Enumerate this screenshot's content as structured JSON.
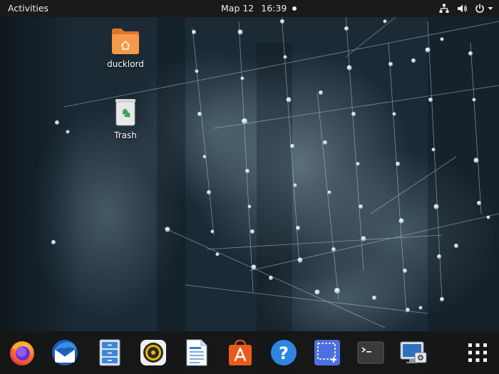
{
  "topbar": {
    "activities_label": "Activities",
    "date": "Мар 12",
    "time": "16:39",
    "tray_icons": [
      "network-icon",
      "volume-icon",
      "power-icon"
    ]
  },
  "desktop": {
    "icons": [
      {
        "label": "ducklord",
        "icon": "home-folder-icon"
      },
      {
        "label": "Trash",
        "icon": "trash-icon"
      }
    ]
  },
  "dock": {
    "items": [
      {
        "icon": "firefox-icon"
      },
      {
        "icon": "thunderbird-icon"
      },
      {
        "icon": "file-manager-icon"
      },
      {
        "icon": "rhythmbox-icon"
      },
      {
        "icon": "libreoffice-writer-icon"
      },
      {
        "icon": "software-center-icon"
      },
      {
        "icon": "help-icon"
      },
      {
        "icon": "screenshot-icon"
      },
      {
        "icon": "terminal-icon"
      },
      {
        "icon": "remote-desktop-icon"
      },
      {
        "icon": "show-applications-icon"
      }
    ]
  },
  "colors": {
    "topbar_bg": "#1a1a1a",
    "dock_bg": "#161616",
    "folder_orange": "#f08a3b",
    "wallpaper_base": "#16222c"
  }
}
